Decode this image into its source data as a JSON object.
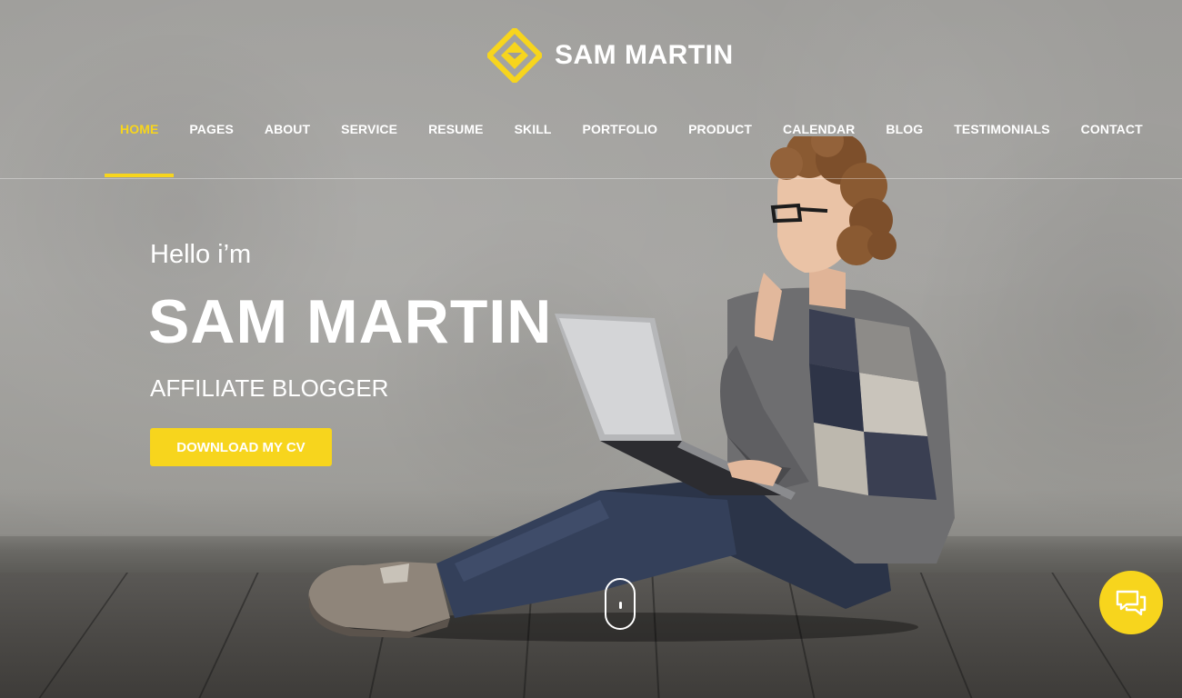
{
  "brand": {
    "name": "SAM MARTIN",
    "accent_color": "#f7d51d"
  },
  "nav": {
    "items": [
      {
        "label": "HOME",
        "active": true
      },
      {
        "label": "PAGES",
        "active": false
      },
      {
        "label": "ABOUT",
        "active": false
      },
      {
        "label": "SERVICE",
        "active": false
      },
      {
        "label": "RESUME",
        "active": false
      },
      {
        "label": "SKILL",
        "active": false
      },
      {
        "label": "PORTFOLIO",
        "active": false
      },
      {
        "label": "PRODUCT",
        "active": false
      },
      {
        "label": "CALENDAR",
        "active": false
      },
      {
        "label": "BLOG",
        "active": false
      },
      {
        "label": "TESTIMONIALS",
        "active": false
      },
      {
        "label": "CONTACT",
        "active": false
      }
    ]
  },
  "hero": {
    "greeting": "Hello i’m",
    "name": "SAM MARTIN",
    "role": "AFFILIATE BLOGGER",
    "cta_label": "DOWNLOAD MY CV"
  },
  "icons": {
    "logo": "diamond-logo-icon",
    "scroll": "mouse-scroll-icon",
    "chat": "chat-bubbles-icon"
  }
}
